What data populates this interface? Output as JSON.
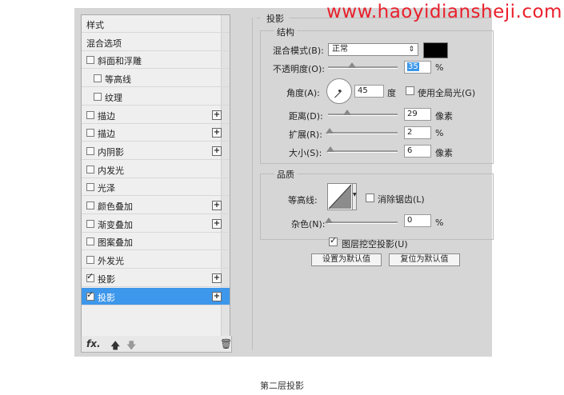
{
  "watermark": "www.haoyidiansheji.com",
  "caption": "第二层投影",
  "colors": {
    "selected": "#3d97ea",
    "shadow_color": "#000000",
    "watermark": "#e9202c"
  },
  "left_panel": {
    "items": [
      {
        "label": "样式",
        "checkbox": false,
        "checked": false,
        "plus": false,
        "indent": 0
      },
      {
        "label": "混合选项",
        "checkbox": false,
        "checked": false,
        "plus": false,
        "indent": 0
      },
      {
        "label": "斜面和浮雕",
        "checkbox": true,
        "checked": false,
        "plus": false,
        "indent": 0
      },
      {
        "label": "等高线",
        "checkbox": true,
        "checked": false,
        "plus": false,
        "indent": 1
      },
      {
        "label": "纹理",
        "checkbox": true,
        "checked": false,
        "plus": false,
        "indent": 1
      },
      {
        "label": "描边",
        "checkbox": true,
        "checked": false,
        "plus": true,
        "indent": 0
      },
      {
        "label": "描边",
        "checkbox": true,
        "checked": false,
        "plus": true,
        "indent": 0
      },
      {
        "label": "内阴影",
        "checkbox": true,
        "checked": false,
        "plus": true,
        "indent": 0
      },
      {
        "label": "内发光",
        "checkbox": true,
        "checked": false,
        "plus": false,
        "indent": 0
      },
      {
        "label": "光泽",
        "checkbox": true,
        "checked": false,
        "plus": false,
        "indent": 0
      },
      {
        "label": "颜色叠加",
        "checkbox": true,
        "checked": false,
        "plus": true,
        "indent": 0
      },
      {
        "label": "渐变叠加",
        "checkbox": true,
        "checked": false,
        "plus": true,
        "indent": 0
      },
      {
        "label": "图案叠加",
        "checkbox": true,
        "checked": false,
        "plus": false,
        "indent": 0
      },
      {
        "label": "外发光",
        "checkbox": true,
        "checked": false,
        "plus": false,
        "indent": 0
      },
      {
        "label": "投影",
        "checkbox": true,
        "checked": true,
        "plus": true,
        "indent": 0
      },
      {
        "label": "投影",
        "checkbox": true,
        "checked": true,
        "plus": true,
        "indent": 0,
        "selected": true
      }
    ],
    "bottom": {
      "fx": "fx.",
      "up_icon": "arrow-up-icon",
      "down_icon": "arrow-down-icon",
      "trash_icon": "trash-icon"
    }
  },
  "right_panel": {
    "section_title": "投影",
    "structure": {
      "title": "结构",
      "blend_mode_label": "混合模式(B):",
      "blend_mode_value": "正常",
      "opacity_label": "不透明度(O):",
      "opacity_value": "35",
      "opacity_percent": 35,
      "angle_label": "角度(A):",
      "angle_value": "45",
      "angle_unit": "度",
      "global_light_label": "使用全局光(G)",
      "distance_label": "距离(D):",
      "distance_value": "29",
      "distance_unit": "像素",
      "spread_label": "扩展(R):",
      "spread_value": "2",
      "spread_unit": "%",
      "size_label": "大小(S):",
      "size_value": "6",
      "size_unit": "像素",
      "percent_unit": "%"
    },
    "quality": {
      "title": "品质",
      "contour_label": "等高线:",
      "antialias_label": "消除锯齿(L)",
      "noise_label": "杂色(N):",
      "noise_value": "0",
      "noise_unit": "%"
    },
    "knockout_label": "图层挖空投影(U)",
    "default_button": "设置为默认值",
    "reset_button": "复位为默认值"
  }
}
